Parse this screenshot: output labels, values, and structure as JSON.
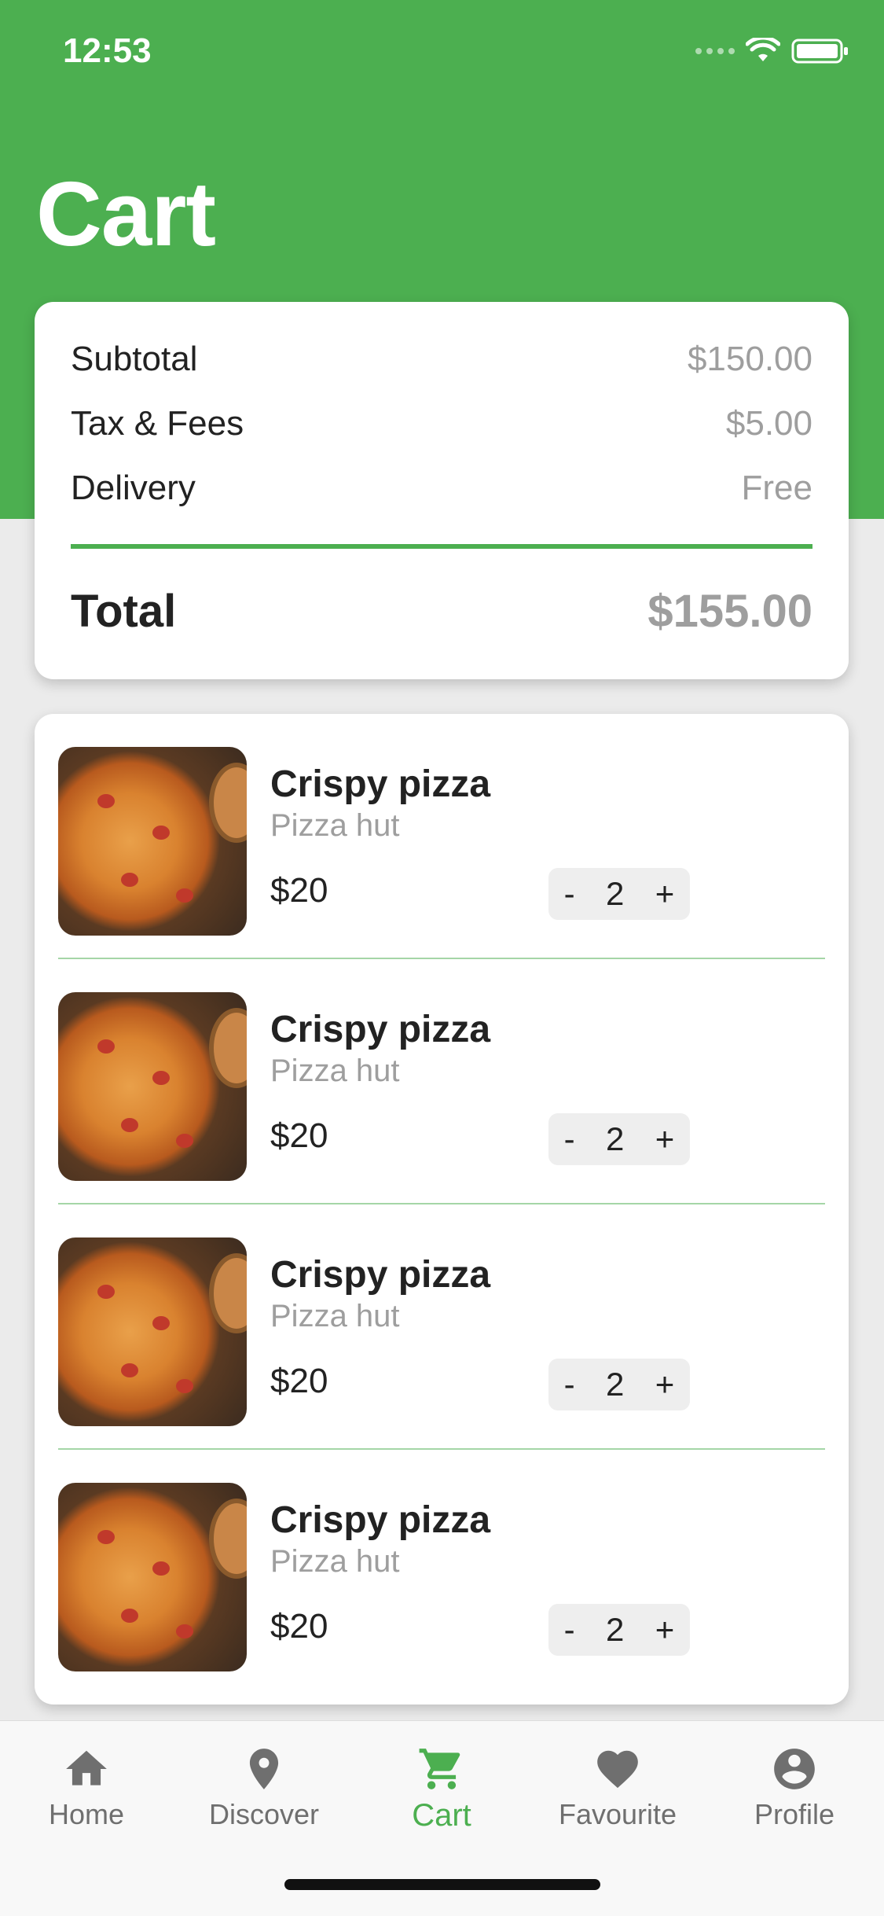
{
  "status_bar": {
    "time": "12:53"
  },
  "page": {
    "title": "Cart"
  },
  "summary": {
    "rows": [
      {
        "label": "Subtotal",
        "value": "$150.00"
      },
      {
        "label": "Tax & Fees",
        "value": "$5.00"
      },
      {
        "label": "Delivery",
        "value": "Free"
      }
    ],
    "total_label": "Total",
    "total_value": "$155.00"
  },
  "items": [
    {
      "name": "Crispy pizza",
      "store": "Pizza hut",
      "price": "$20",
      "quantity": "2",
      "minus": "-",
      "plus": "+"
    },
    {
      "name": "Crispy pizza",
      "store": "Pizza hut",
      "price": "$20",
      "quantity": "2",
      "minus": "-",
      "plus": "+"
    },
    {
      "name": "Crispy pizza",
      "store": "Pizza hut",
      "price": "$20",
      "quantity": "2",
      "minus": "-",
      "plus": "+"
    },
    {
      "name": "Crispy pizza",
      "store": "Pizza hut",
      "price": "$20",
      "quantity": "2",
      "minus": "-",
      "plus": "+"
    }
  ],
  "tabs": [
    {
      "label": "Home",
      "icon": "home-icon"
    },
    {
      "label": "Discover",
      "icon": "location-pin-icon"
    },
    {
      "label": "Cart",
      "icon": "cart-icon",
      "active": true
    },
    {
      "label": "Favourite",
      "icon": "heart-icon"
    },
    {
      "label": "Profile",
      "icon": "account-circle-icon"
    }
  ],
  "colors": {
    "brand": "#4caf50",
    "muted_text": "#9e9e9e",
    "divider_light": "#a5d6a7"
  }
}
